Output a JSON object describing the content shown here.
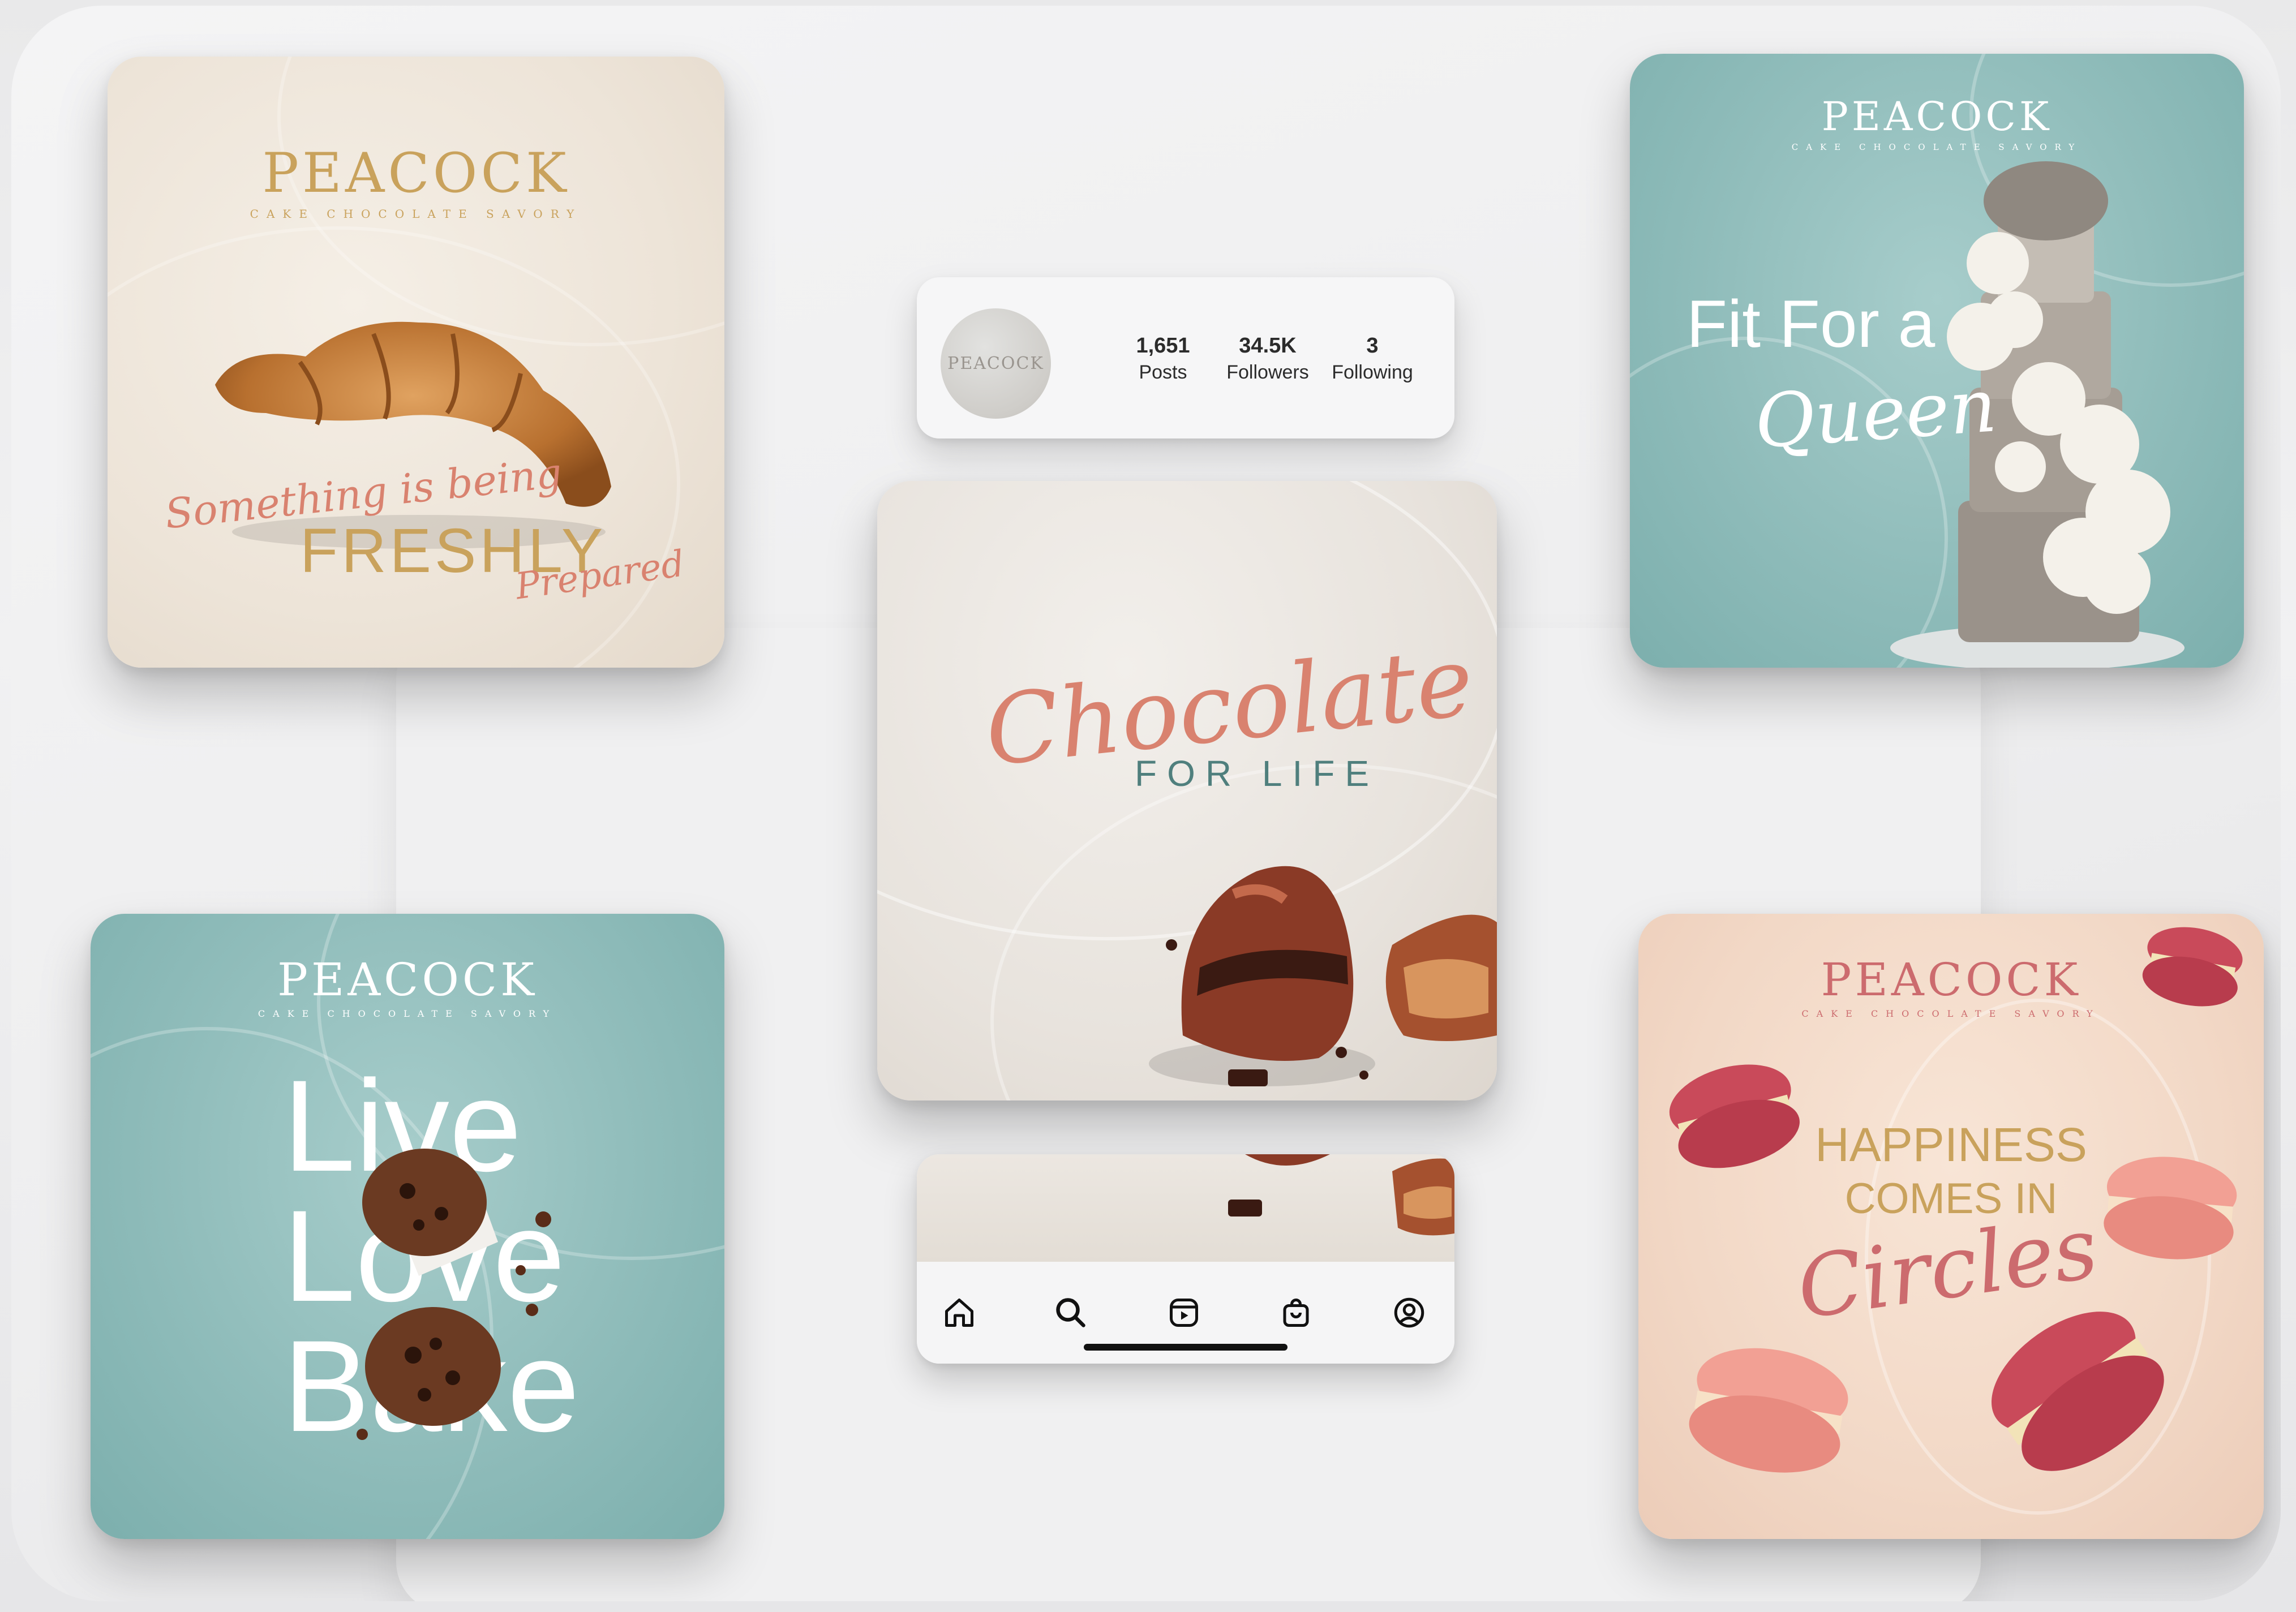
{
  "profile": {
    "avatar_text": "PEACOCK",
    "stats": [
      {
        "value": "1,651",
        "label": "Posts"
      },
      {
        "value": "34.5K",
        "label": "Followers"
      },
      {
        "value": "3",
        "label": "Following"
      }
    ]
  },
  "brand": {
    "name": "PEACOCK",
    "tagline": "CAKE CHOCOLATE SAVORY"
  },
  "posts": {
    "croissant": {
      "line1": "Something is being",
      "line2": "FRESHLY",
      "line3": "Prepared"
    },
    "cake": {
      "line1": "Fit For a",
      "line2": "Queen"
    },
    "chocolate": {
      "line1": "Chocolate",
      "line2": "FOR LIFE"
    },
    "muffin": {
      "word1": "Live",
      "word2": "Love",
      "word3": "Bake"
    },
    "macaron": {
      "line1": "HAPPINESS",
      "line2": "COMES IN",
      "line3": "Circles"
    }
  },
  "nav": {
    "icons": [
      "home-icon",
      "search-icon",
      "reels-icon",
      "shop-icon",
      "profile-icon"
    ]
  },
  "colors": {
    "gold": "#c9a25c",
    "coral": "#d9826f",
    "teal": "#8fbcba",
    "peach": "#f2d8c6",
    "cream": "#ede4d8",
    "rose": "#cc6b6e"
  }
}
